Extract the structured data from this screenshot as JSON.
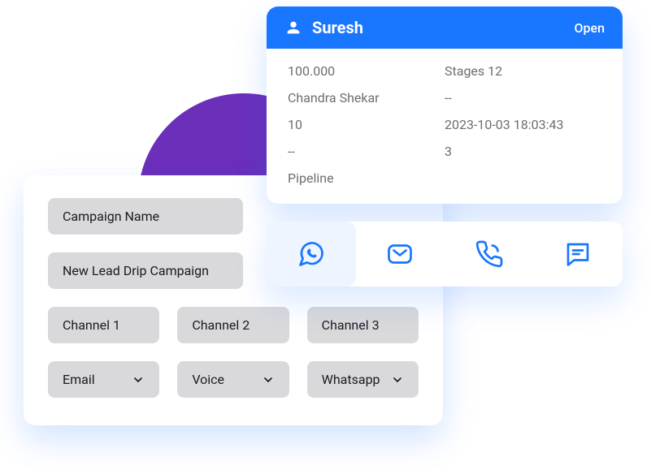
{
  "contact": {
    "name": "Suresh",
    "status": "Open",
    "left": {
      "amount": "100.000",
      "owner": "Chandra Shekar",
      "ten": "10",
      "dash": "--",
      "pipeline": "Pipeline"
    },
    "right": {
      "stages": "Stages 12",
      "dash": "--",
      "timestamp": "2023-10-03 18:03:43",
      "three": "3"
    }
  },
  "campaign": {
    "name_label": "Campaign Name",
    "name_value": "New Lead Drip Campaign",
    "channels": {
      "ch1_label": "Channel 1",
      "ch2_label": "Channel 2",
      "ch3_label": "Channel 3",
      "ch1_value": "Email",
      "ch2_value": "Voice",
      "ch3_value": "Whatsapp"
    }
  }
}
